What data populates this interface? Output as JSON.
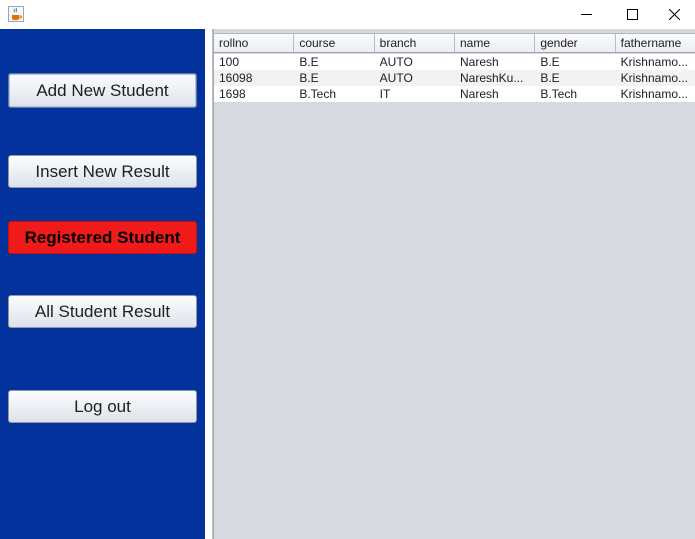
{
  "window": {
    "app_icon": "java-coffee-cup-icon",
    "controls": {
      "minimize": "minimize-icon",
      "maximize": "maximize-icon",
      "close": "close-icon"
    }
  },
  "sidebar": {
    "background": "#04329c",
    "buttons": {
      "add_new_student": "Add New Student",
      "insert_new_result": "Insert New Result",
      "registered_student": "Registered Student",
      "all_student_result": "All Student Result",
      "log_out": "Log out"
    },
    "active_color": "#f11a1a"
  },
  "table": {
    "columns": [
      "rollno",
      "course",
      "branch",
      "name",
      "gender",
      "fathername"
    ],
    "rows": [
      [
        "100",
        "B.E",
        "AUTO",
        "Naresh",
        "B.E",
        "Krishnamo..."
      ],
      [
        "16098",
        "B.E",
        "AUTO",
        "NareshKu...",
        "B.E",
        "Krishnamo..."
      ],
      [
        "1698",
        "B.Tech",
        "IT",
        "Naresh",
        "B.Tech",
        "Krishnamo..."
      ]
    ]
  }
}
